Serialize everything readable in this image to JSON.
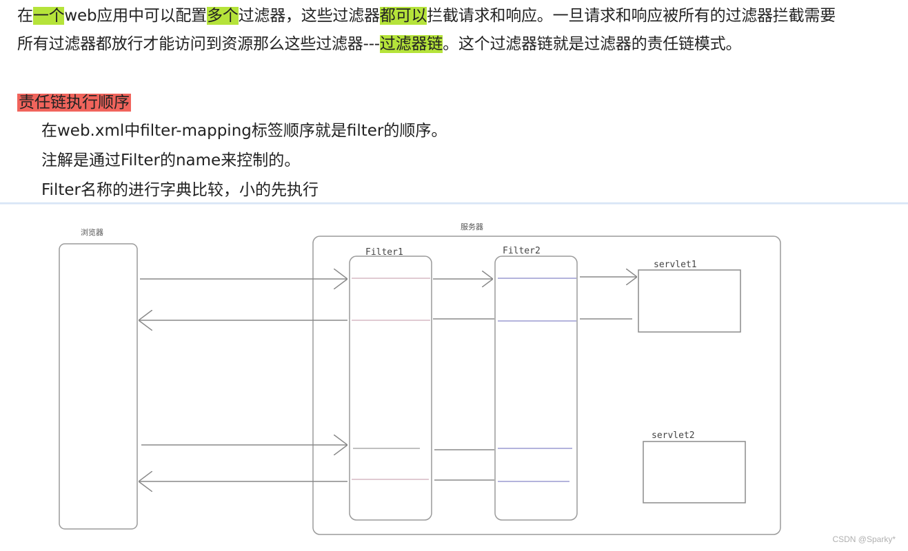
{
  "intro": {
    "line1": [
      {
        "text": "在",
        "hl": ""
      },
      {
        "text": "一个",
        "hl": "green"
      },
      {
        "text": "web应用中可以配置",
        "hl": ""
      },
      {
        "text": "多个",
        "hl": "green"
      },
      {
        "text": "过滤器，这些过滤器",
        "hl": ""
      },
      {
        "text": "都可以",
        "hl": "green"
      },
      {
        "text": "拦截请求和响应。一旦请求和响应被所有的过滤器拦截需要",
        "hl": ""
      }
    ],
    "line2": [
      {
        "text": "所有过滤器都放行才能访问到资源那么这些过滤器---",
        "hl": ""
      },
      {
        "text": "过滤器链",
        "hl": "green"
      },
      {
        "text": "。这个过滤器链就是过滤器的责任链模式。",
        "hl": ""
      }
    ]
  },
  "section": {
    "heading": "责任链执行顺序",
    "lines": [
      "在web.xml中filter-mapping标签顺序就是filter的顺序。",
      "注解是通过Filter的name来控制的。",
      "Filter名称的进行字典比较，小的先执行"
    ]
  },
  "diagram": {
    "browser_label": "浏览器",
    "server_label": "服务器",
    "filter1_label": "Filter1",
    "filter2_label": "Filter2",
    "servlet1_label": "servlet1",
    "servlet2_label": "servlet2"
  },
  "colors": {
    "highlight_green": "#b5e33a",
    "highlight_red": "#f1645c"
  },
  "watermark": "CSDN @Sparky*"
}
